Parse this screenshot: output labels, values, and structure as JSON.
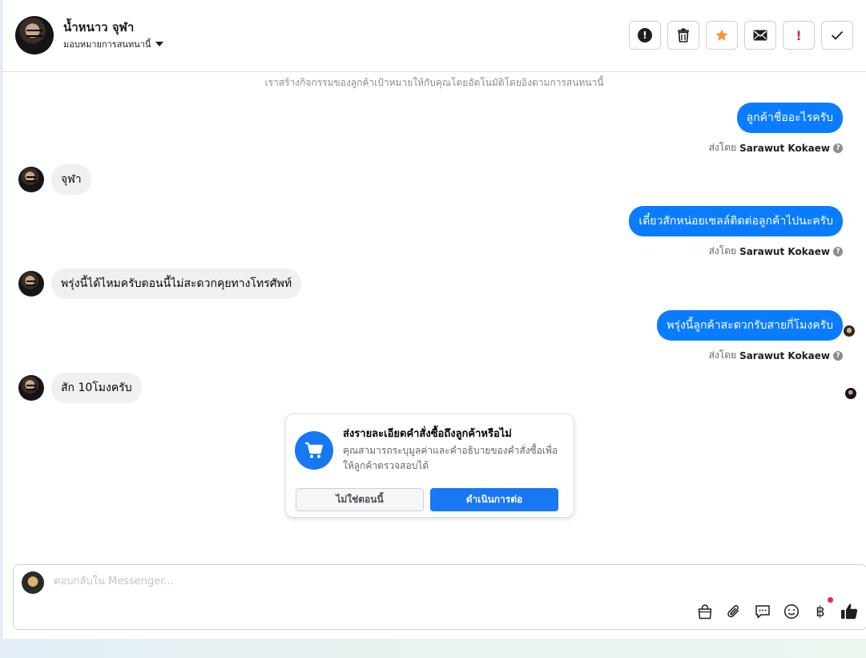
{
  "header": {
    "contact_name": "น้ำหนาว จุฬา",
    "assign_label": "มอบหมายการสนทนานี้",
    "toolbar": {
      "items": [
        {
          "name": "mark-spam-button",
          "icon": "alert-circle-icon"
        },
        {
          "name": "delete-button",
          "icon": "trash-icon"
        },
        {
          "name": "star-button",
          "icon": "star-icon"
        },
        {
          "name": "mark-unread-button",
          "icon": "envelope-icon"
        },
        {
          "name": "follow-up-button",
          "icon": "red-exclamation-icon"
        },
        {
          "name": "mark-done-button",
          "icon": "check-icon"
        }
      ]
    }
  },
  "conversation": {
    "system_note": "เราสร้างกิจกรรมของลูกค้าเป้าหมายให้กับคุณโดยอัตโนมัติโดยอิงตามการสนทนานี้",
    "sent_by_prefix": "ส่งโดย",
    "help_glyph": "?",
    "messages": [
      {
        "direction": "out",
        "text": "ลูกค้าชื่ออะไรครับ",
        "sender": "Sarawut Kokaew"
      },
      {
        "direction": "in",
        "text": "จุฬา"
      },
      {
        "direction": "out",
        "text": "เดี๋ยวสักหน่อยเซลล์ติดต่อลูกค้าไปนะครับ",
        "sender": "Sarawut Kokaew"
      },
      {
        "direction": "in",
        "text": "พรุ่งนี้ได้ไหมครับตอนนี้ไม่สะดวกคุยทางโทรศัพท์"
      },
      {
        "direction": "out",
        "text": "พรุ่งนี้ลูกค้าสะดวกรับสายกี่โมงครับ",
        "sender": "Sarawut Kokaew"
      },
      {
        "direction": "in",
        "text": "สัก 10โมงครับ"
      }
    ]
  },
  "order_card": {
    "title": "ส่งรายละเอียดคำสั่งซื้อถึงลูกค้าหรือไม่",
    "description": "คุณสามารถระบุมูลค่าและคำอธิบายของคำสั่งซื้อเพื่อให้ลูกค้าตรวจสอบได้",
    "secondary_button": "ไม่ใช่ตอนนี้",
    "primary_button": "ดำเนินการต่อ"
  },
  "composer": {
    "placeholder": "ตอบกลับใน Messenger...",
    "baht_glyph": "฿",
    "tools": [
      "shopping-bag-icon",
      "paperclip-icon",
      "saved-reply-icon",
      "emoji-icon",
      "baht-icon",
      "thumbs-up-icon"
    ]
  },
  "colors": {
    "accent": "#1877f2",
    "outgoing_bubble": "#0a7cff",
    "incoming_bubble": "#f0f0f0",
    "star": "#f7923b",
    "alert_red": "#e41e3f"
  }
}
